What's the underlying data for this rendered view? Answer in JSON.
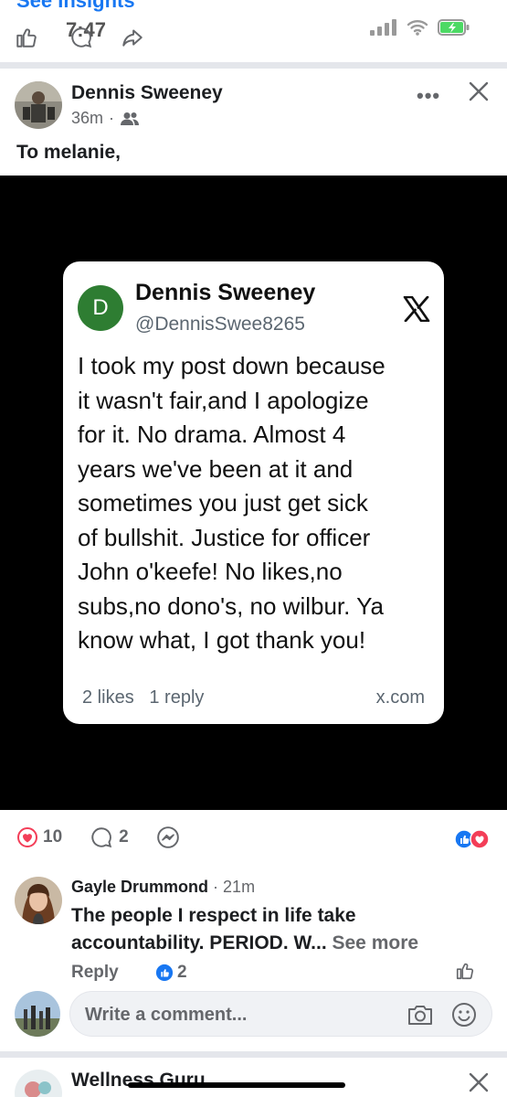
{
  "status_bar": {
    "time": "7:47",
    "partial_header": "See Insights"
  },
  "post": {
    "author": "Dennis Sweeney",
    "time": "36m",
    "audience_icon": "friends-icon",
    "text": "To melanie,",
    "more_icon": "more-dots-icon",
    "close_icon": "close-icon"
  },
  "tweet": {
    "avatar_letter": "D",
    "name": "Dennis Sweeney",
    "handle": "@DennisSwee8265",
    "lines": [
      "I took my post down because",
      "it wasn't fair,and I apologize",
      "for it. No drama. Almost 4",
      "years we've been at it and",
      "sometimes you just get sick",
      "of bullshit. Justice for officer",
      "John o'keefe! No likes,no",
      "subs,no dono's, no wilbur. Ya",
      "know what, I got thank you!"
    ],
    "footer_stats": "2 likes   1 reply",
    "source": "x.com"
  },
  "reactions": {
    "count": "10",
    "comments": "2"
  },
  "comment": {
    "author": "Gayle Drummond",
    "time": "21m",
    "text": "The people I respect in life take accountability. PERIOD. W...",
    "see_more": "See more",
    "reply": "Reply",
    "likes": "2"
  },
  "comment_input": {
    "placeholder": "Write a comment..."
  },
  "next_post": {
    "author": "Wellness Guru"
  },
  "colors": {
    "accent": "#1877f2",
    "love": "#f33e58",
    "tweet_avatar": "#2e7d32"
  }
}
